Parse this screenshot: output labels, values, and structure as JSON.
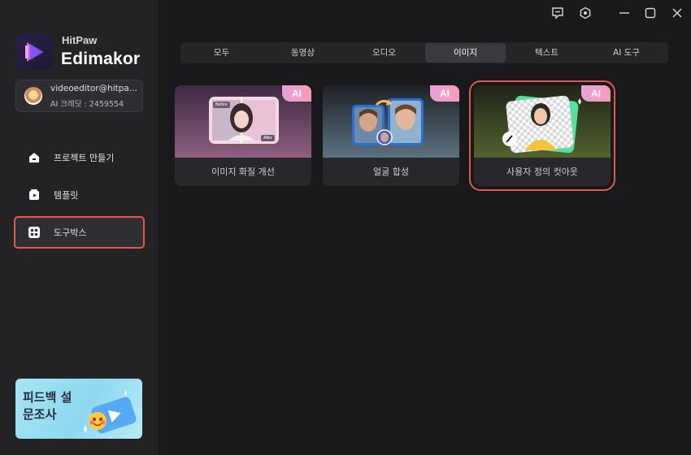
{
  "app": {
    "brand_top": "HitPaw",
    "brand_main": "Edimakor"
  },
  "account": {
    "email": "videoeditor@hitpa...",
    "credit": "AI 크레딧 : 2459554"
  },
  "sidebar": {
    "items": [
      {
        "label": "프로젝트 만들기",
        "icon": "home-icon"
      },
      {
        "label": "템플릿",
        "icon": "template-icon"
      },
      {
        "label": "도구박스",
        "icon": "toolbox-icon"
      }
    ],
    "active_index": 2
  },
  "promo": {
    "text": "피드백 설문조사"
  },
  "window_controls": [
    "feedback-icon",
    "settings-icon",
    "minimize-icon",
    "maximize-icon",
    "close-icon"
  ],
  "tabs": [
    {
      "label": "모두"
    },
    {
      "label": "동영상"
    },
    {
      "label": "오디오"
    },
    {
      "label": "이미지"
    },
    {
      "label": "텍스트"
    },
    {
      "label": "AI 도구"
    }
  ],
  "selected_tab": "이미지",
  "cards": [
    {
      "label": "이미지 화질 개선",
      "badge": "AI",
      "before": "Before",
      "after": "After"
    },
    {
      "label": "얼굴 합성",
      "badge": "AI"
    },
    {
      "label": "사용자 정의 컷아웃",
      "badge": "AI"
    }
  ],
  "colors": {
    "accent_highlight": "#e2584d",
    "background": "#19191c",
    "sidebar": "#232326"
  }
}
